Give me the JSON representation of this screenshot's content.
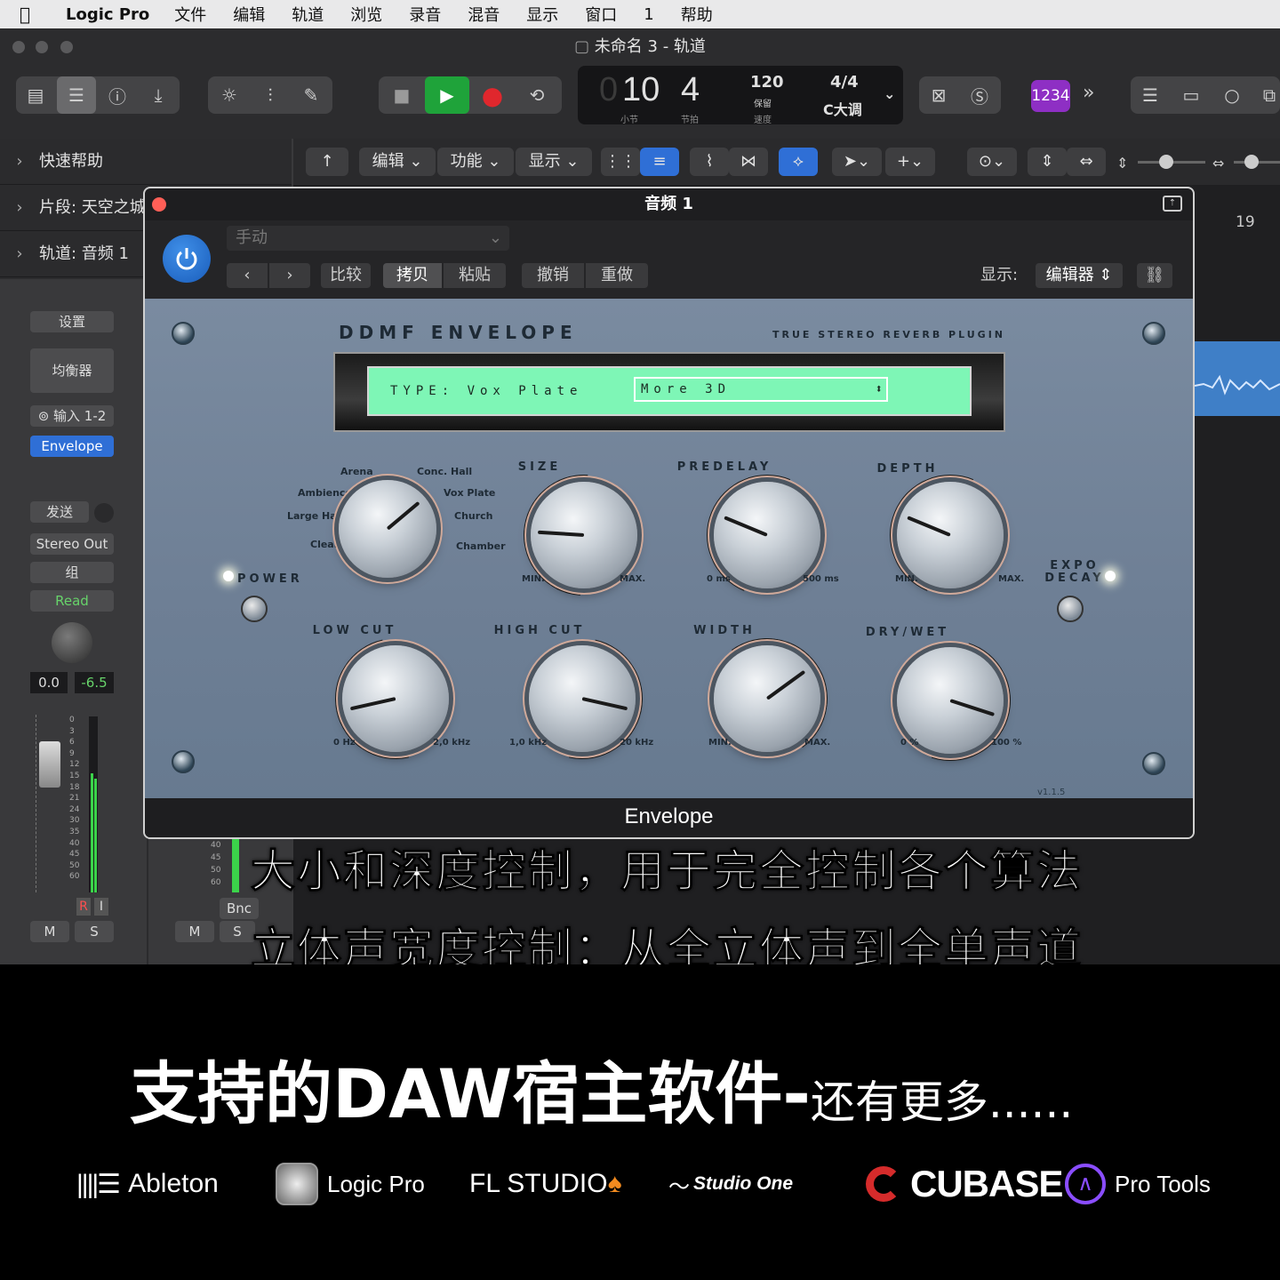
{
  "menubar": {
    "app": "Logic Pro",
    "items": [
      "文件",
      "编辑",
      "轨道",
      "浏览",
      "录音",
      "混音",
      "显示",
      "窗口",
      "1",
      "帮助"
    ]
  },
  "window": {
    "title": "未命名 3 - 轨道"
  },
  "lcd": {
    "bar": "10",
    "beat": "4",
    "bar_label": "小节",
    "beat_label": "节拍",
    "tempo": "120",
    "tempo_mode": "保留",
    "tempo_label": "速度",
    "signature": "4/4",
    "key": "C大调"
  },
  "toolbar": {
    "counter_badge": "1234"
  },
  "inspector": {
    "quick_help": "快速帮助",
    "region": "片段: 天空之城",
    "track": "轨道: 音频 1",
    "setting": "设置",
    "eq": "均衡器",
    "input": "输入 1-2",
    "plugin_slot": "Envelope",
    "sends": "发送",
    "output": "Stereo Out",
    "group": "组",
    "automation": "Read",
    "volume": "0.0",
    "peak": "-6.5",
    "meter_scale": [
      "0",
      "3",
      "6",
      "9",
      "12",
      "15",
      "18",
      "21",
      "24",
      "30",
      "35",
      "40",
      "45",
      "50",
      "60"
    ],
    "meter_scale_right": [
      "40",
      "45",
      "50",
      "60"
    ],
    "record": "R",
    "input_mon": "I",
    "mute": "M",
    "solo": "S",
    "bounce": "Bnc"
  },
  "track_area": {
    "edit": "编辑",
    "functions": "功能",
    "view": "显示",
    "ruler_number": "19"
  },
  "plugin": {
    "title": "音频 1",
    "preset_placeholder": "手动",
    "compare": "比较",
    "copy": "拷贝",
    "paste": "粘贴",
    "undo": "撤销",
    "redo": "重做",
    "view_label": "显示:",
    "view_value": "编辑器",
    "footer": "Envelope",
    "brand": "DDMF ENVELOPE",
    "tagline": "TRUE STEREO REVERB PLUGIN",
    "type_label": "TYPE: Vox Plate",
    "preset": "More 3D",
    "version": "v1.1.5",
    "power_label": "POWER",
    "expo_decay": "EXPO DECAY",
    "types": [
      "Arena",
      "Conc. Hall",
      "Ambience",
      "Vox Plate",
      "Large Hall",
      "Church",
      "Clean",
      "Chamber"
    ],
    "knobs": [
      {
        "label": "SIZE",
        "min": "MIN.",
        "max": "MAX.",
        "value": 0.18
      },
      {
        "label": "PREDELAY",
        "min": "0 ms",
        "max": "500 ms",
        "value": 0.25
      },
      {
        "label": "DEPTH",
        "min": "MIN.",
        "max": "MAX.",
        "value": 0.25
      },
      {
        "label": "LOW CUT",
        "min": "0 Hz",
        "max": "2,0 kHz",
        "value": 0.12
      },
      {
        "label": "HIGH CUT",
        "min": "1,0 kHz",
        "max": "20 kHz",
        "value": 0.88
      },
      {
        "label": "WIDTH",
        "min": "MIN.",
        "max": "MAX.",
        "value": 0.7
      },
      {
        "label": "DRY/WET",
        "min": "0 %",
        "max": "100 %",
        "value": 0.9
      }
    ]
  },
  "captions": {
    "line1": "大小和深度控制，用于完全控制各个算法",
    "line2": "立体声宽度控制：从全立体声到全单声道"
  },
  "banner": {
    "headline": "支持的DAW宿主软件-",
    "headline_sub": "还有更多......",
    "daws": [
      "Ableton",
      "Logic Pro",
      "FL STUDIO",
      "Studio One",
      "CUBASE",
      "Pro Tools"
    ]
  },
  "colors": {
    "lcd_green": "#7ef6b6",
    "play_green": "#1fa33a",
    "record_red": "#e0272d",
    "power_blue": "#2f7fde",
    "badge_purple": "#8e2fc4",
    "panel_blue": "#72849a"
  }
}
